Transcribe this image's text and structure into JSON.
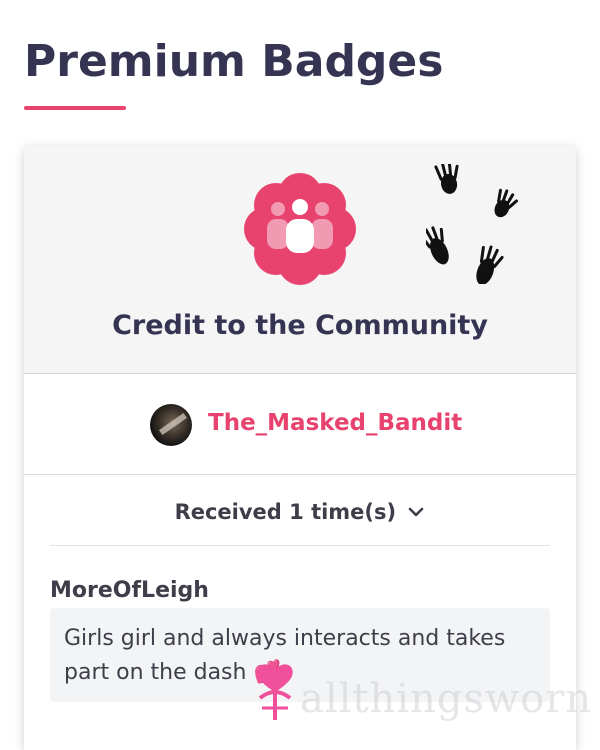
{
  "page": {
    "title": "Premium Badges"
  },
  "badge": {
    "name": "Credit to the Community",
    "icon": "community-people-icon",
    "icon_color": "#e8426e",
    "decoration": "paw-prints-icon",
    "recipient": {
      "username": "The_Masked_Bandit",
      "avatar": "avatar"
    },
    "received_label": "Received 1 time(s)",
    "received_icon": "chevron-down-icon"
  },
  "comments": [
    {
      "author": "MoreOfLeigh",
      "text": "Girls girl and always interacts and takes part on the dash 💕"
    }
  ],
  "watermark": {
    "text": "allthingsworn"
  },
  "colors": {
    "accent": "#e8426e",
    "heading": "#353452",
    "text": "#3e3e4a",
    "header_bg": "#f5f5f6"
  }
}
